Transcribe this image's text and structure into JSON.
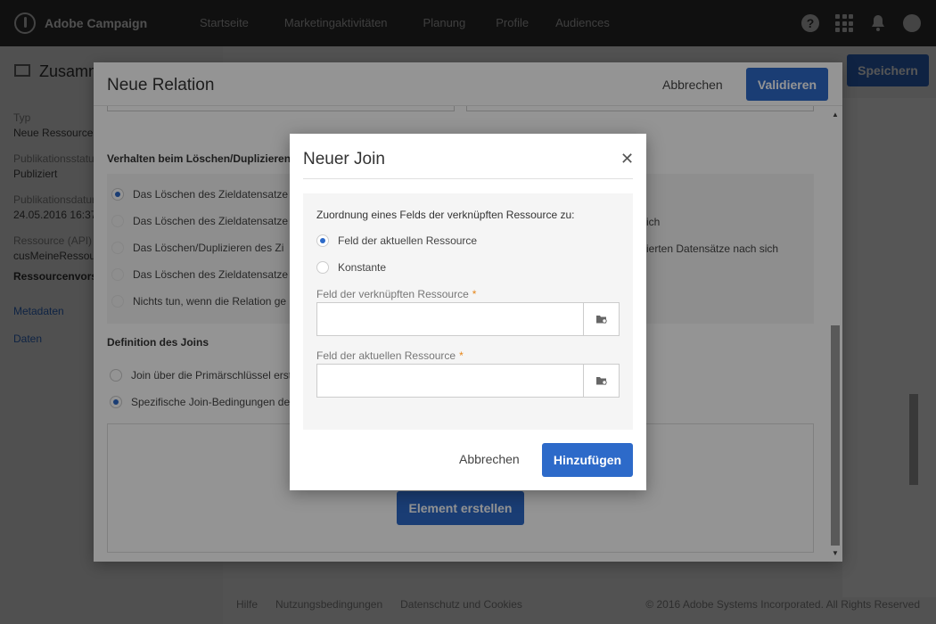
{
  "topbar": {
    "app_name": "Adobe Campaign",
    "nav": [
      "Startseite",
      "Marketingaktivitäten",
      "Planung",
      "Profile",
      "Audiences"
    ],
    "help_glyph": "?"
  },
  "sidebar": {
    "title": "Zusamm",
    "items": [
      {
        "label": "Typ",
        "value": "Neue Ressource"
      },
      {
        "label": "Publikationsstatus",
        "value": "Publiziert"
      },
      {
        "label": "Publikationsdatum",
        "value": "24.05.2016 16:37:3"
      },
      {
        "label": "Ressource (API)",
        "value": "cusMeineRessour"
      }
    ],
    "section": "Ressourcenvorsc",
    "links": [
      "Metadaten",
      "Daten"
    ]
  },
  "header": {
    "save_label": "Speichern"
  },
  "footer": {
    "links": [
      "Hilfe",
      "Nutzungsbedingungen",
      "Datenschutz und Cookies"
    ],
    "copyright": "© 2016 Adobe Systems Incorporated. All Rights Reserved"
  },
  "relation_dialog": {
    "title": "Neue Relation",
    "cancel_label": "Abbrechen",
    "validate_label": "Validieren",
    "delete_section_title": "Verhalten beim Löschen/Duplizieren",
    "delete_options": [
      "Das Löschen des Zieldatensatze",
      "Das Löschen des Zieldatensatze",
      "Das Löschen/Duplizieren des Zi",
      "Das Löschen des Zieldatensatze",
      "Nichts tun, wenn die Relation ge"
    ],
    "delete_options_right": [
      "ich",
      "ierten Datensätze nach sich"
    ],
    "join_section_title": "Definition des Joins",
    "join_options": [
      "Join über die Primärschlüssel erste",
      "Spezifische Join-Bedingungen defin"
    ],
    "create_element_label": "Element erstellen"
  },
  "join_dialog": {
    "title": "Neuer Join",
    "close_glyph": "✕",
    "mapping_label": "Zuordnung eines Felds der verknüpften Ressource zu:",
    "options": [
      "Feld der aktuellen Ressource",
      "Konstante"
    ],
    "field_linked_label": "Feld der verknüpften Ressource",
    "field_current_label": "Feld der aktuellen Ressource",
    "required_mark": "*",
    "field_linked_value": "",
    "field_current_value": "",
    "cancel_label": "Abbrechen",
    "add_label": "Hinzufügen"
  },
  "colors": {
    "accent": "#2d6ac9",
    "topbar": "#323232",
    "required": "#e68619"
  }
}
